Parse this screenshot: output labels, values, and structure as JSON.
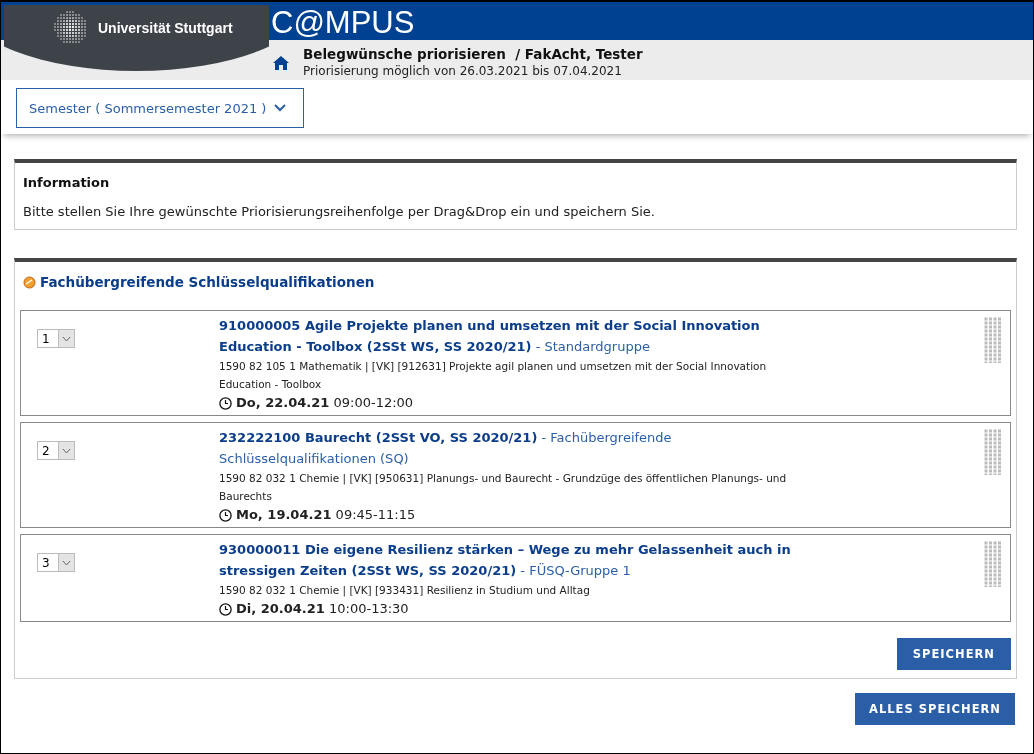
{
  "header": {
    "university": "Universität Stuttgart",
    "brand": "C@MPUS",
    "page_title": "Belegwünsche priorisieren  / FakAcht, Tester",
    "period": "Priorisierung möglich von 26.03.2021 bis 07.04.2021"
  },
  "semester_dropdown": {
    "label": "Semester ( Sommersemester 2021 )"
  },
  "information": {
    "title": "Information",
    "text": "Bitte stellen Sie Ihre gewünschte Priorisierungsreihenfolge per Drag&Drop ein und speichern Sie."
  },
  "section": {
    "title": "Fachübergreifende Schlüsselqualifikationen",
    "courses": [
      {
        "rank": "1",
        "title": "**910000005 Agile Projekte planen und umsetzen mit der Social Innovation Education - Toolbox (2SSt WS, SS 2020/21)** - Standardgruppe",
        "details": "1590 82 105 1 Mathematik | [VK] [912631] Projekte agil planen und umsetzen mit der Social Innovation Education - Toolbox",
        "date": "**Do, 22.04.21** 09:00-12:00"
      },
      {
        "rank": "2",
        "title": "**232222100 Baurecht (2SSt VO, SS 2020/21)** - Fachübergreifende Schlüsselqualifikationen (SQ)",
        "details": "1590 82 032 1 Chemie | [VK] [950631] Planungs- und Baurecht - Grundzüge des öffentlichen Planungs- und Baurechts",
        "date": "**Mo, 19.04.21** 09:45-11:15"
      },
      {
        "rank": "3",
        "title": "**930000011 Die eigene Resilienz stärken – Wege zu mehr Gelassenheit auch in stressigen Zeiten (2SSt WS, SS 2020/21)** - FÜSQ-Gruppe 1",
        "details": "1590 82 032 1 Chemie | [VK] [933431] Resilienz in Studium und Alltag",
        "date": "**Di, 20.04.21** 10:00-13:30"
      }
    ],
    "save_button": "SPEICHERN"
  },
  "save_all_button": "ALLES SPEICHERN"
}
